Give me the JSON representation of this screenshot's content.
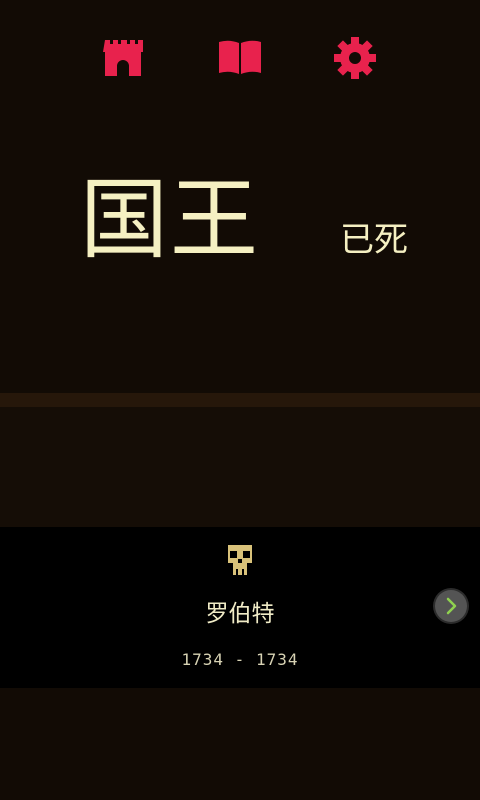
{
  "colors": {
    "accent": "#e8224d",
    "title_text": "#f5f0c2",
    "skull": "#d9c27a",
    "next_arrow": "#8fd14f",
    "background": "#120b05",
    "panel": "#000000"
  },
  "toolbar": {
    "icons": [
      "castle-icon",
      "book-icon",
      "gear-icon"
    ]
  },
  "headline": {
    "main": "国王",
    "sub": "已死"
  },
  "king": {
    "name": "罗伯特",
    "years": "1734 - 1734",
    "icon": "skull-icon"
  },
  "next": {
    "icon": "chevron-right-icon"
  }
}
